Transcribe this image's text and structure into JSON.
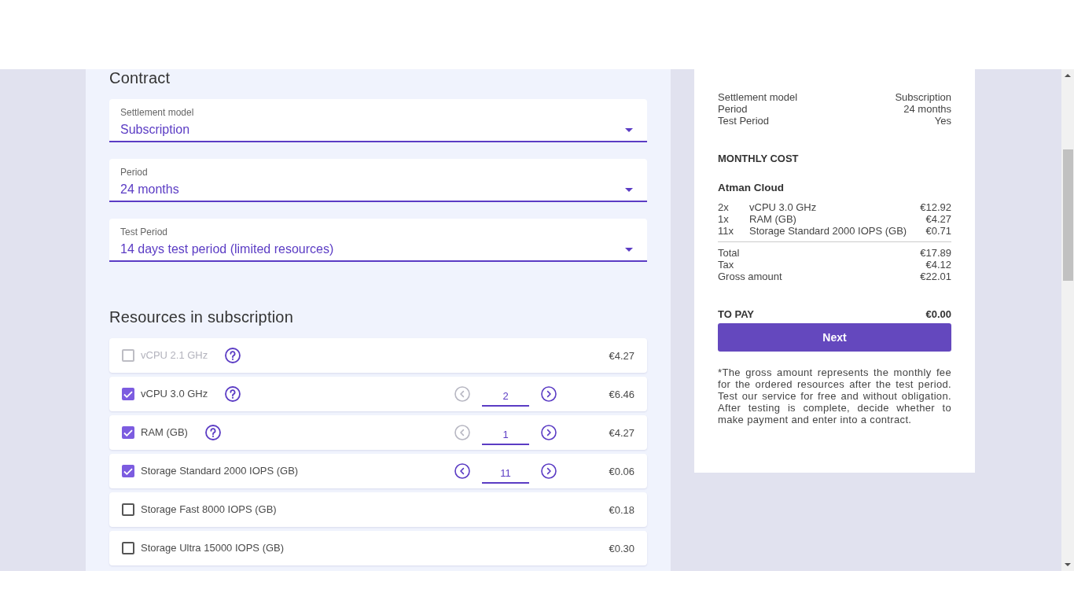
{
  "contract": {
    "title": "Contract",
    "fields": [
      {
        "label": "Settlement model",
        "value": "Subscription"
      },
      {
        "label": "Period",
        "value": "24 months"
      },
      {
        "label": "Test Period",
        "value": "14 days test period (limited resources)"
      }
    ]
  },
  "resources": {
    "title": "Resources in subscription",
    "items": [
      {
        "name": "vCPU 2.1 GHz",
        "checked": false,
        "disabled": true,
        "help": true,
        "price": "€4.27"
      },
      {
        "name": "vCPU 3.0 GHz",
        "checked": true,
        "disabled": false,
        "help": true,
        "stepper": {
          "value": "2",
          "decrease_disabled": true
        },
        "price": "€6.46"
      },
      {
        "name": "RAM (GB)",
        "checked": true,
        "disabled": false,
        "help": true,
        "stepper": {
          "value": "1",
          "decrease_disabled": true
        },
        "price": "€4.27"
      },
      {
        "name": "Storage Standard 2000 IOPS (GB)",
        "checked": true,
        "disabled": false,
        "help": false,
        "stepper": {
          "value": "11",
          "decrease_disabled": false
        },
        "price": "€0.06"
      },
      {
        "name": "Storage Fast 8000 IOPS (GB)",
        "checked": false,
        "disabled": false,
        "help": false,
        "price": "€0.18"
      },
      {
        "name": "Storage Ultra 15000 IOPS (GB)",
        "checked": false,
        "disabled": false,
        "help": false,
        "price": "€0.30"
      }
    ]
  },
  "summary": {
    "contract_rows": [
      {
        "label": "Settlement model",
        "value": "Subscription"
      },
      {
        "label": "Period",
        "value": "24 months"
      },
      {
        "label": "Test Period",
        "value": "Yes"
      }
    ],
    "monthly_cost_title": "MONTHLY COST",
    "provider": "Atman Cloud",
    "lines": [
      {
        "quantity": "2x",
        "name": "vCPU 3.0 GHz",
        "amount": "€12.92"
      },
      {
        "quantity": "1x",
        "name": "RAM (GB)",
        "amount": "€4.27"
      },
      {
        "quantity": "11x",
        "name": "Storage Standard 2000 IOPS (GB)",
        "amount": "€0.71"
      }
    ],
    "totals": [
      {
        "label": "Total",
        "value": "€17.89"
      },
      {
        "label": "Tax",
        "value": "€4.12"
      },
      {
        "label": "Gross amount",
        "value": "€22.01"
      }
    ],
    "to_pay": {
      "label": "TO PAY",
      "value": "€0.00"
    },
    "button": "Next",
    "note": "*The gross amount represents the monthly fee for the ordered resources after the test period. Test our service for free and without obligation. After testing is complete, decide whether to make payment and enter into a contract."
  }
}
